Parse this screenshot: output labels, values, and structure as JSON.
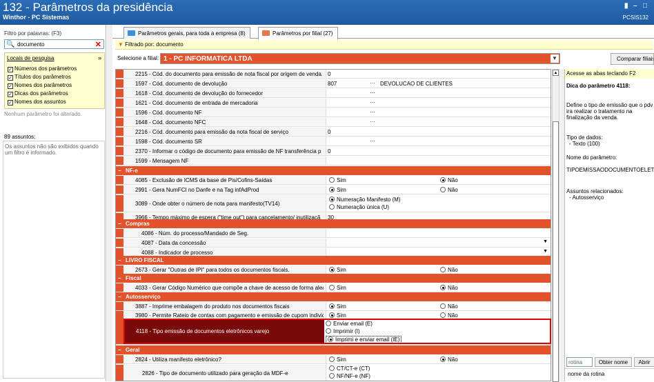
{
  "window": {
    "title": "132 - Parâmetros da presidência",
    "subtitle": "Winthor - PC Sistemas",
    "code": "PCSIS132",
    "buttons": [
      "▮",
      "–",
      "□"
    ]
  },
  "left": {
    "filter_label": "Filtro por palavras: (F3)",
    "search_value": "documento",
    "locais_title": "Locais de pesquisa",
    "locais": [
      "Números dos parâmetros",
      "Títulos dos parâmetros",
      "Nomes dos parâmetros",
      "Dicas dos parâmetros",
      "Nomes dos assuntos"
    ],
    "none_changed": "Nenhum parâmetro foi alterado.",
    "assuntos_count": "89 assuntos:",
    "assuntos_note_1": "Os assuntos não são exibidos quando",
    "assuntos_note_2": "um filtro é informado."
  },
  "tabs": [
    {
      "label": "Parâmetros gerais, para toda a empresa  (8)"
    },
    {
      "label": "Parâmetros por filial  (27)"
    }
  ],
  "filtered_by": "Filtrado por: documento",
  "filial": {
    "label": "Selecione a filial:",
    "value": "1 - PC INFORMATICA LTDA"
  },
  "compare_button": "Comparar filiais",
  "rows": [
    {
      "name": "2215 - Cód. do documento para emissão de nota fiscal por origem de venda",
      "value": "0"
    },
    {
      "name": "1597 - Cód. documento de devolução",
      "value": "807",
      "dots": "···",
      "desc": "DEVOLUCAO DE CLIENTES"
    },
    {
      "name": "1618 - Cód. documento de devolução do fornecedor",
      "value": "",
      "dots": "···"
    },
    {
      "name": "1621 - Cód. documento de entrada de mercadoria",
      "value": "",
      "dots": "···"
    },
    {
      "name": "1596 - Cód. documento NF",
      "value": "",
      "dots": "···"
    },
    {
      "name": "1648 - Cód. documento NFC",
      "value": "",
      "dots": "···"
    },
    {
      "name": "2216 - Cód. documento para emissão da nota fiscal de serviço",
      "value": "0"
    },
    {
      "name": "1598 - Cód. documento SR",
      "value": "",
      "dots": "···"
    },
    {
      "name": "2370 - Informar o código de documento para emissão de NF transferência p",
      "value": "0"
    },
    {
      "name": "1599 - Mensagem NF",
      "value": ""
    }
  ],
  "sections": {
    "nfe": "NF-e",
    "compras": "Compras",
    "livro": "LIVRO FISCAL",
    "fiscal": "Fiscal",
    "auto": "Autosserviço",
    "geral": "Geral"
  },
  "nfe_rows": [
    {
      "name": "4085 - Exclusão de ICMS da base de Pis/Cofins-Saídas",
      "opt1": "Sim",
      "opt2": "Não"
    },
    {
      "name": "2991 - Gera NumFCI no Danfe e na Tag infAdProd",
      "opt1": "Sim",
      "opt2": "Não"
    },
    {
      "name": "3089 - Onde obter o número de nota para manifesto(TV14)",
      "opt1": "Numeração Manifesto (M)",
      "opt2": "Numeração única (U)"
    },
    {
      "name": "3966 - Tempo máximo de espera (\"time out\") para cancelamento/ inutilizaçã",
      "value": "30"
    }
  ],
  "compras_rows": [
    {
      "name": "4086 - Núm. do processo/Mandado de Seg."
    },
    {
      "name": "4087 - Data da concessão",
      "dd": "▼"
    },
    {
      "name": "4088 - Indicador de processo",
      "dd": "▼"
    }
  ],
  "livro_rows": [
    {
      "name": "2673 - Gerar \"Outras de IPI\" para todos os documentos fiscais.",
      "opt1": "Sim",
      "opt2": "Não"
    }
  ],
  "fiscal_rows": [
    {
      "name": "4033 - Gerar Código Numérico que compõe a chave de acesso de forma alea",
      "opt1": "Sim",
      "opt2": "Não"
    }
  ],
  "auto_rows": [
    {
      "name": "3887 - Imprime embalagem do produto nos documentos fiscais",
      "opt1": "Sim",
      "opt2": "Não"
    },
    {
      "name": "3980 - Permite Rateio de contas com pagamento e emissão de cupom individ",
      "opt1": "Sim",
      "opt2": "Não"
    }
  ],
  "highlight": {
    "name": "4118 - Tipo emissão de documentos eletrônicos varejo",
    "opts": [
      "Enviar email (E)",
      "Imprimir (I)",
      "Imprimi e enviar email (IE)"
    ]
  },
  "geral_rows": [
    {
      "name": "2824 - Utiliza manifesto eletrônico?",
      "opt1": "Sim",
      "opt2": "Não"
    },
    {
      "name": "2826 - Tipo de documento utilizado para geração da MDF-e",
      "opt1": "CT/CT-e (CT)",
      "opt2": "NF/NF-e (NF)"
    }
  ],
  "right": {
    "hint": "Acesse as abas teclando F2",
    "dica_title": "Dica do parâmetro 4118:",
    "desc1": "Define o tipo de emissão que o pdv",
    "desc2": "ira realizar o tratamento na",
    "desc3": "finalização da venda.",
    "tipo_label": "Tipo de dados:",
    "tipo_value": "- Texto (100)",
    "nome_label": "Nome do parâmetro:",
    "nome_value": "TIPOEMISSAODOCUMENTOELETRO",
    "assuntos_label": "Assuntos relacionados:",
    "assuntos_value": "- Autosserviço",
    "rotina_placeholder": "rotina",
    "obter": "Obter nome",
    "abrir": "Abrir",
    "nome_rotina": "nome da rotina"
  }
}
